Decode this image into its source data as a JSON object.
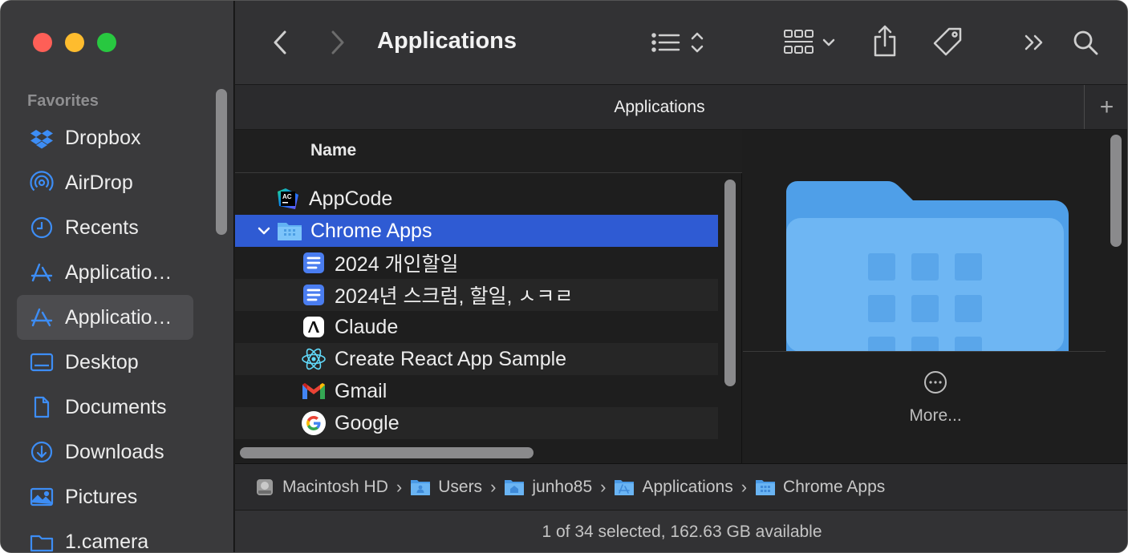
{
  "window": {
    "title": "Applications",
    "tab_label": "Applications",
    "tab_add": "+"
  },
  "sidebar": {
    "heading": "Favorites",
    "items": [
      {
        "label": "Dropbox",
        "icon": "dropbox-icon"
      },
      {
        "label": "AirDrop",
        "icon": "airdrop-icon"
      },
      {
        "label": "Recents",
        "icon": "clock-icon"
      },
      {
        "label": "Applicatio…",
        "icon": "applications-icon"
      },
      {
        "label": "Applicatio…",
        "icon": "applications-icon",
        "active": true
      },
      {
        "label": "Desktop",
        "icon": "desktop-icon"
      },
      {
        "label": "Documents",
        "icon": "document-icon"
      },
      {
        "label": "Downloads",
        "icon": "download-icon"
      },
      {
        "label": "Pictures",
        "icon": "pictures-icon"
      },
      {
        "label": "1.camera",
        "icon": "folder-icon"
      }
    ]
  },
  "list": {
    "column_header": "Name",
    "rows": [
      {
        "label": "AppCode",
        "icon": "appcode-icon"
      },
      {
        "label": "Chrome Apps",
        "icon": "folder-icon",
        "selected": true,
        "expanded": true
      },
      {
        "label": "2024 개인할일",
        "icon": "google-docs-icon"
      },
      {
        "label": "2024년 스크럼, 할일, ㅅㅋㄹ",
        "icon": "google-docs-icon"
      },
      {
        "label": "Claude",
        "icon": "claude-icon"
      },
      {
        "label": "Create React App Sample",
        "icon": "react-icon"
      },
      {
        "label": "Gmail",
        "icon": "gmail-icon"
      },
      {
        "label": "Google",
        "icon": "google-icon"
      }
    ]
  },
  "preview": {
    "more_label": "More..."
  },
  "pathbar": {
    "crumbs": [
      {
        "label": "Macintosh HD",
        "icon": "hard-drive-icon"
      },
      {
        "label": "Users",
        "icon": "users-folder-icon"
      },
      {
        "label": "junho85",
        "icon": "home-folder-icon"
      },
      {
        "label": "Applications",
        "icon": "applications-folder-icon"
      },
      {
        "label": "Chrome Apps",
        "icon": "chrome-apps-folder-icon"
      }
    ],
    "separator": "›"
  },
  "status": {
    "text": "1 of 34 selected, 162.63 GB available"
  },
  "colors": {
    "accent": "#2f5bd3",
    "sidebar_icon": "#3d8df5",
    "folder": "#5aaef0"
  }
}
